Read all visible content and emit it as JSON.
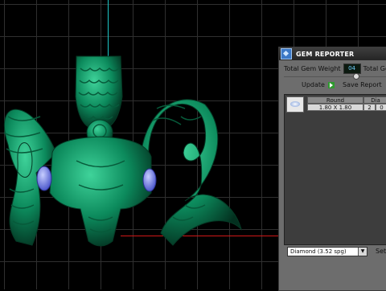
{
  "panel": {
    "title": "GEM REPORTER",
    "total_gem_weight_label": "Total Gem Weight",
    "total_gem_weight_value": "04",
    "total_gem_label_2": "Total Ge",
    "update_label": "Update",
    "save_report_label": "Save Report",
    "table": {
      "headers": [
        "Round",
        "Dia"
      ],
      "row": [
        "1.80 X 1.80",
        "2",
        "0"
      ]
    },
    "stone_select": "Diamond    (3.52 spg)",
    "set_label": "Set"
  },
  "colors": {
    "model_green": "#0c8a5c",
    "y_axis": "#1ec6c6",
    "x_axis": "#d01818",
    "gem_blue": "#5a6fe8"
  }
}
